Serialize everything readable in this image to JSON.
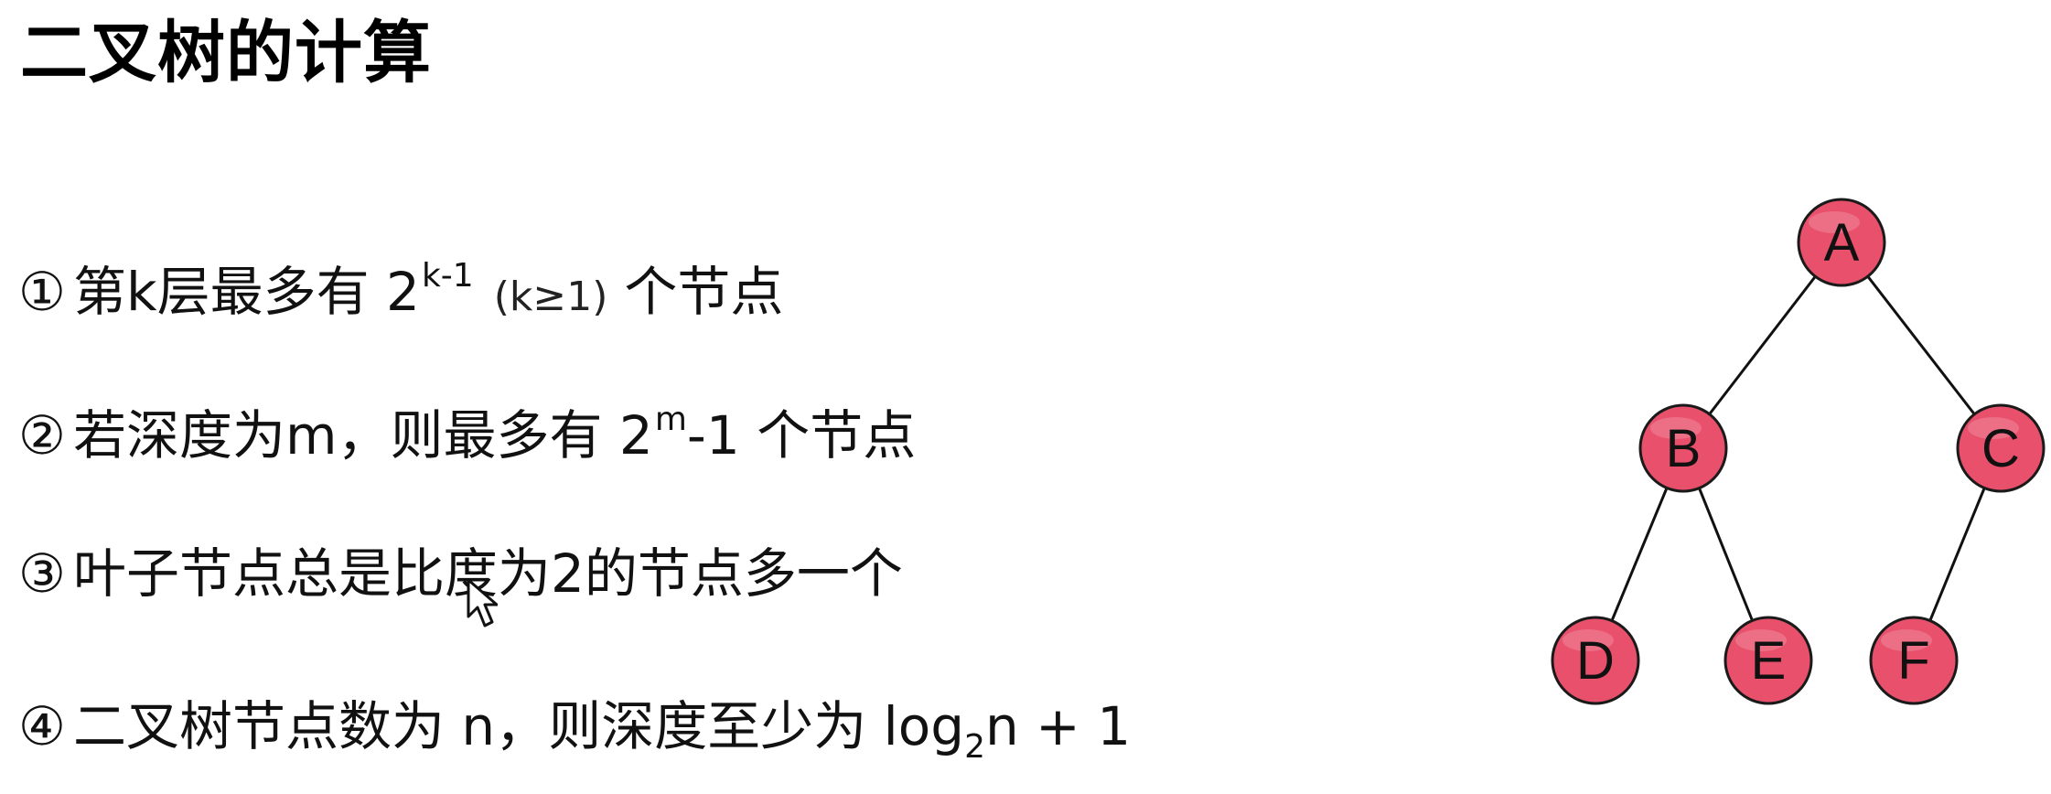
{
  "slide": {
    "title": "二叉树的计算"
  },
  "rules": [
    {
      "marker": "①",
      "text_before": "第k层最多有 2",
      "superscript": "k-1",
      "small_text": "(k≥1)",
      "text_after": "个节点"
    },
    {
      "marker": "②",
      "text_before": "若深度为m，则最多有 2",
      "superscript": "m",
      "text_after": "-1 个节点"
    },
    {
      "marker": "③",
      "text": "叶子节点总是比度为2的节点多一个"
    },
    {
      "marker": "④",
      "text_before": "二叉树节点数为 n，则深度至少为 log",
      "subscript": "2",
      "text_after": "n + 1"
    }
  ],
  "tree": {
    "node_color": "#e8506b",
    "node_border_color": "#1a1a1a",
    "edge_color": "#111111",
    "nodes": [
      {
        "id": "A",
        "label": "A"
      },
      {
        "id": "B",
        "label": "B"
      },
      {
        "id": "C",
        "label": "C"
      },
      {
        "id": "D",
        "label": "D"
      },
      {
        "id": "E",
        "label": "E"
      },
      {
        "id": "F",
        "label": "F"
      }
    ],
    "edges": [
      [
        "A",
        "B"
      ],
      [
        "A",
        "C"
      ],
      [
        "B",
        "D"
      ],
      [
        "B",
        "E"
      ],
      [
        "C",
        "F"
      ]
    ]
  },
  "cursor": {
    "icon": "arrow-cursor-icon"
  }
}
